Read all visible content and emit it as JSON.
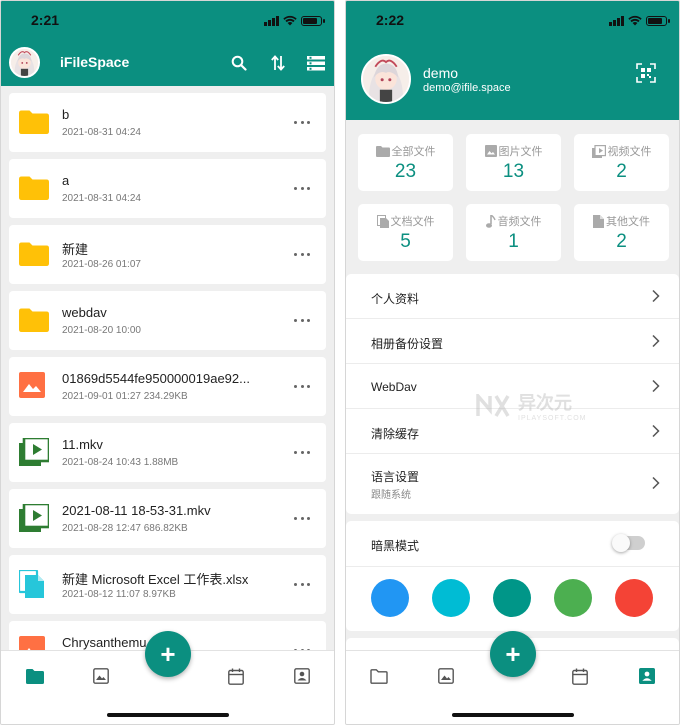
{
  "colors": {
    "primary": "#0b8f80",
    "folder": "#ffc107",
    "image_file": "#ff7043",
    "video_file": "#2e7d32",
    "doc_file": "#26c6da"
  },
  "left": {
    "status_time": "2:21",
    "app_title": "iFileSpace",
    "files": [
      {
        "name": "b",
        "meta": "2021-08-31 04:24",
        "icon": "folder-icon"
      },
      {
        "name": "a",
        "meta": "2021-08-31 04:24",
        "icon": "folder-icon"
      },
      {
        "name": "新建",
        "meta": "2021-08-26 01:07",
        "icon": "folder-icon"
      },
      {
        "name": "webdav",
        "meta": "2021-08-20 10:00",
        "icon": "folder-icon"
      },
      {
        "name": "01869d5544fe950000019ae92...",
        "meta": "2021-09-01 01:27  234.29KB",
        "icon": "image-file-icon"
      },
      {
        "name": "11.mkv",
        "meta": "2021-08-24 10:43  1.88MB",
        "icon": "video-file-icon"
      },
      {
        "name": "2021-08-11 18-53-31.mkv",
        "meta": "2021-08-28 12:47  686.82KB",
        "icon": "video-file-icon"
      },
      {
        "name": "新建 Microsoft Excel 工作表.xlsx",
        "meta": "2021-08-12 11:07  8.97KB",
        "icon": "document-file-icon"
      },
      {
        "name": "Chrysanthemu",
        "meta": "",
        "icon": "image-file-icon"
      }
    ],
    "fab_label": "+"
  },
  "right": {
    "status_time": "2:22",
    "user_name": "demo",
    "user_email": "demo@ifile.space",
    "stats": [
      {
        "label": "全部文件",
        "value": "23",
        "icon": "folder-icon"
      },
      {
        "label": "图片文件",
        "value": "13",
        "icon": "image-icon"
      },
      {
        "label": "视频文件",
        "value": "2",
        "icon": "video-icon"
      },
      {
        "label": "文档文件",
        "value": "5",
        "icon": "document-icon"
      },
      {
        "label": "音频文件",
        "value": "1",
        "icon": "music-icon"
      },
      {
        "label": "其他文件",
        "value": "2",
        "icon": "other-file-icon"
      }
    ],
    "menu": [
      {
        "label": "个人资料",
        "sub": ""
      },
      {
        "label": "相册备份设置",
        "sub": ""
      },
      {
        "label": "WebDav",
        "sub": ""
      },
      {
        "label": "清除缓存",
        "sub": ""
      },
      {
        "label": "语言设置",
        "sub": "跟随系统"
      }
    ],
    "dark_mode_label": "暗黑模式",
    "dark_mode_on": false,
    "theme_colors": [
      "#2196f3",
      "#00bcd4",
      "#009688",
      "#4caf50",
      "#f44336"
    ],
    "fab_label": "+",
    "watermark_title": "异次元",
    "watermark_sub": "IPLAYSOFT.COM"
  }
}
